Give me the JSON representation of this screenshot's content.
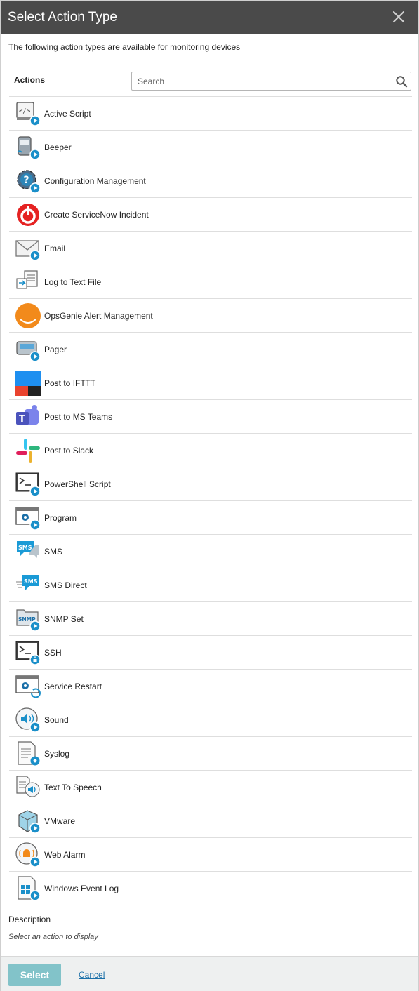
{
  "dialog": {
    "title": "Select Action Type",
    "subtitle": "The following action types are available for monitoring devices"
  },
  "actions_header": {
    "label": "Actions",
    "search_placeholder": "Search"
  },
  "actions": [
    {
      "label": "Active Script",
      "icon": "script-icon"
    },
    {
      "label": "Beeper",
      "icon": "beeper-icon"
    },
    {
      "label": "Configuration Management",
      "icon": "config-gear-icon"
    },
    {
      "label": "Create ServiceNow Incident",
      "icon": "servicenow-icon"
    },
    {
      "label": "Email",
      "icon": "email-icon"
    },
    {
      "label": "Log to Text File",
      "icon": "log-file-icon"
    },
    {
      "label": "OpsGenie Alert Management",
      "icon": "opsgenie-icon"
    },
    {
      "label": "Pager",
      "icon": "pager-icon"
    },
    {
      "label": "Post to IFTTT",
      "icon": "ifttt-icon"
    },
    {
      "label": "Post to MS Teams",
      "icon": "ms-teams-icon"
    },
    {
      "label": "Post to Slack",
      "icon": "slack-icon"
    },
    {
      "label": "PowerShell Script",
      "icon": "powershell-icon"
    },
    {
      "label": "Program",
      "icon": "program-icon"
    },
    {
      "label": "SMS",
      "icon": "sms-icon"
    },
    {
      "label": "SMS Direct",
      "icon": "sms-direct-icon"
    },
    {
      "label": "SNMP Set",
      "icon": "snmp-icon"
    },
    {
      "label": "SSH",
      "icon": "ssh-icon"
    },
    {
      "label": "Service Restart",
      "icon": "service-restart-icon"
    },
    {
      "label": "Sound",
      "icon": "sound-icon"
    },
    {
      "label": "Syslog",
      "icon": "syslog-icon"
    },
    {
      "label": "Text To Speech",
      "icon": "text-to-speech-icon"
    },
    {
      "label": "VMware",
      "icon": "vmware-icon"
    },
    {
      "label": "Web Alarm",
      "icon": "web-alarm-icon"
    },
    {
      "label": "Windows Event Log",
      "icon": "windows-event-log-icon"
    }
  ],
  "description": {
    "label": "Description",
    "text": "Select an action to display"
  },
  "footer": {
    "select_label": "Select",
    "cancel_label": "Cancel"
  },
  "colors": {
    "title_bar": "#4a4a4a",
    "select_button": "#82c3c9",
    "link": "#1a6fa8",
    "play_badge": "#1a8fc9"
  }
}
